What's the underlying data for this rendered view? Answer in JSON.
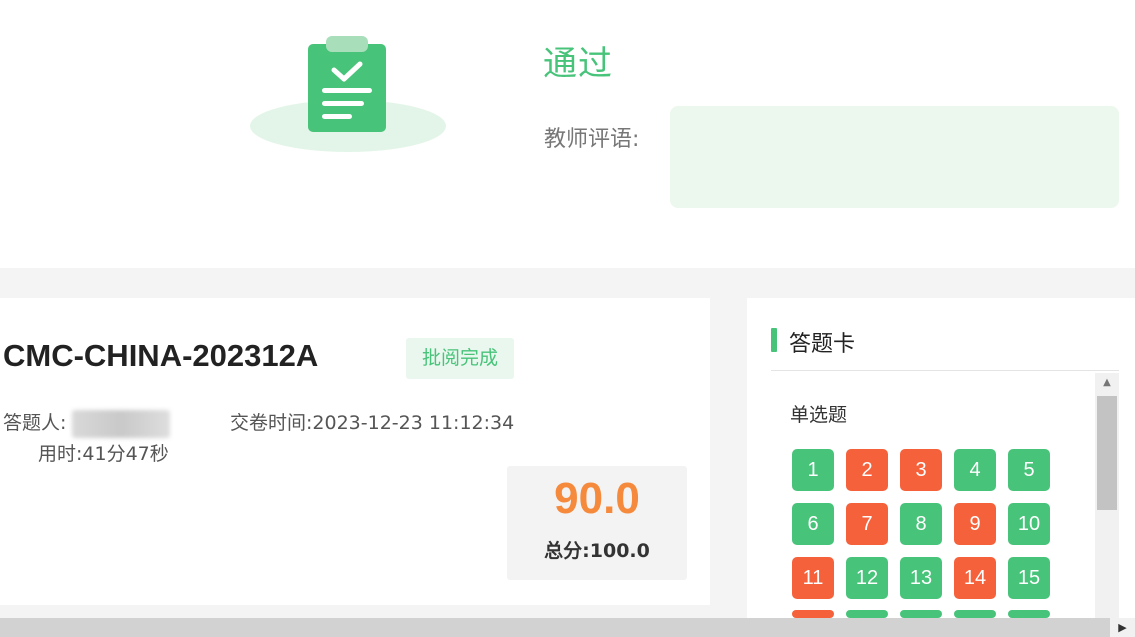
{
  "result": {
    "status": "通过",
    "comment_label": "教师评语:",
    "comment_text": ""
  },
  "exam": {
    "title": "CMC-CHINA-202312A",
    "status_tag": "批阅完成",
    "respondent_label": "答题人:",
    "submit_label": "交卷时间:",
    "submit_time": "2023-12-23 11:12:34",
    "duration_label": "用时:",
    "duration": "41分47秒"
  },
  "score": {
    "value": "90.0",
    "total_label": "总分:",
    "total": "100.0"
  },
  "answer_card": {
    "title": "答题卡",
    "section": "单选题",
    "questions": [
      {
        "n": "1",
        "result": "correct"
      },
      {
        "n": "2",
        "result": "wrong"
      },
      {
        "n": "3",
        "result": "wrong"
      },
      {
        "n": "4",
        "result": "correct"
      },
      {
        "n": "5",
        "result": "correct"
      },
      {
        "n": "6",
        "result": "correct"
      },
      {
        "n": "7",
        "result": "wrong"
      },
      {
        "n": "8",
        "result": "correct"
      },
      {
        "n": "9",
        "result": "wrong"
      },
      {
        "n": "10",
        "result": "correct"
      },
      {
        "n": "11",
        "result": "wrong"
      },
      {
        "n": "12",
        "result": "correct"
      },
      {
        "n": "13",
        "result": "correct"
      },
      {
        "n": "14",
        "result": "wrong"
      },
      {
        "n": "15",
        "result": "correct"
      }
    ]
  },
  "colors": {
    "accent": "#48c37a",
    "wrong": "#f5613b",
    "score": "#f5893c"
  },
  "icons": {
    "illustration": "clipboard-check-icon",
    "scroll_up": "triangle-up-icon",
    "scroll_right": "triangle-right-icon"
  }
}
